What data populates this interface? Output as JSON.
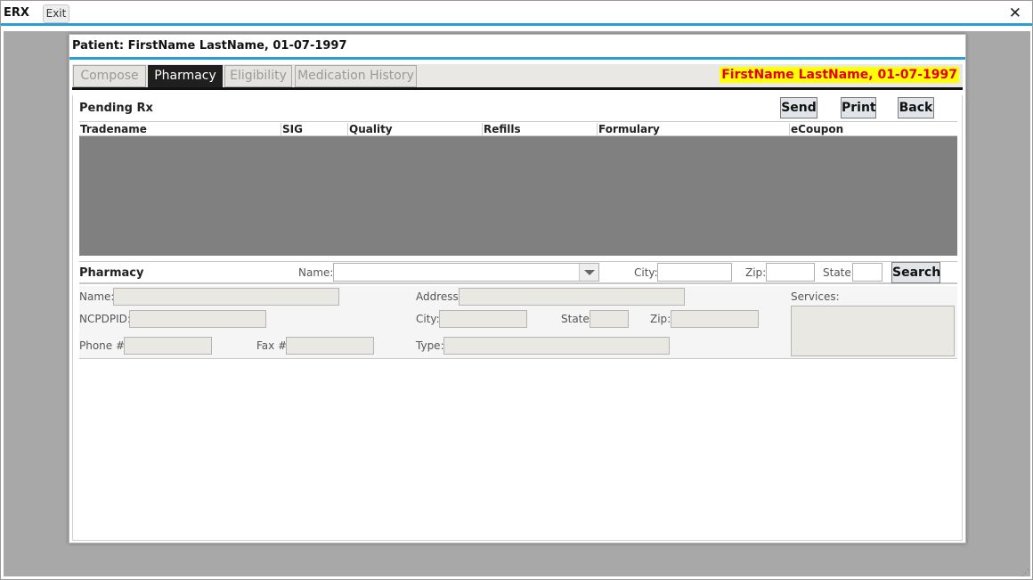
{
  "app": {
    "title": "ERX",
    "exit_label": "Exit",
    "close_glyph": "✕"
  },
  "patient": {
    "header": "Patient: FirstName LastName, 01-07-1997",
    "banner": "FirstName LastName, 01-07-1997"
  },
  "tabs": [
    {
      "label": "Compose",
      "active": false
    },
    {
      "label": "Pharmacy",
      "active": true
    },
    {
      "label": "Eligibility",
      "active": false
    },
    {
      "label": "Medication History",
      "active": false
    }
  ],
  "pending_rx": {
    "title": "Pending Rx",
    "buttons": {
      "send": "Send",
      "print": "Print",
      "back": "Back"
    },
    "columns": [
      "Tradename",
      "SIG",
      "Quality",
      "Refills",
      "Formulary",
      "eCoupon"
    ],
    "rows": []
  },
  "pharmacy_search": {
    "title": "Pharmacy",
    "name_label": "Name:",
    "name_value": "",
    "city_label": "City:",
    "city_value": "",
    "zip_label": "Zip:",
    "zip_value": "",
    "state_label": "State:",
    "state_value": "",
    "search_label": "Search"
  },
  "pharmacy_details": {
    "name_label": "Name:",
    "name_value": "",
    "address_label": "Address:",
    "address_value": "",
    "services_label": "Services:",
    "services_value": "",
    "ncpdpid_label": "NCPDPID:",
    "ncpdpid_value": "",
    "city_label": "City:",
    "city_value": "",
    "state_label": "State:",
    "state_value": "",
    "zip_label": "Zip:",
    "zip_value": "",
    "phone_label": "Phone #:",
    "phone_value": "",
    "fax_label": "Fax #:",
    "fax_value": "",
    "type_label": "Type:",
    "type_value": ""
  },
  "colors": {
    "accent": "#2a9fd6",
    "banner_bg": "#ffff00",
    "banner_text": "#e2001a",
    "grid_body": "#808080"
  }
}
